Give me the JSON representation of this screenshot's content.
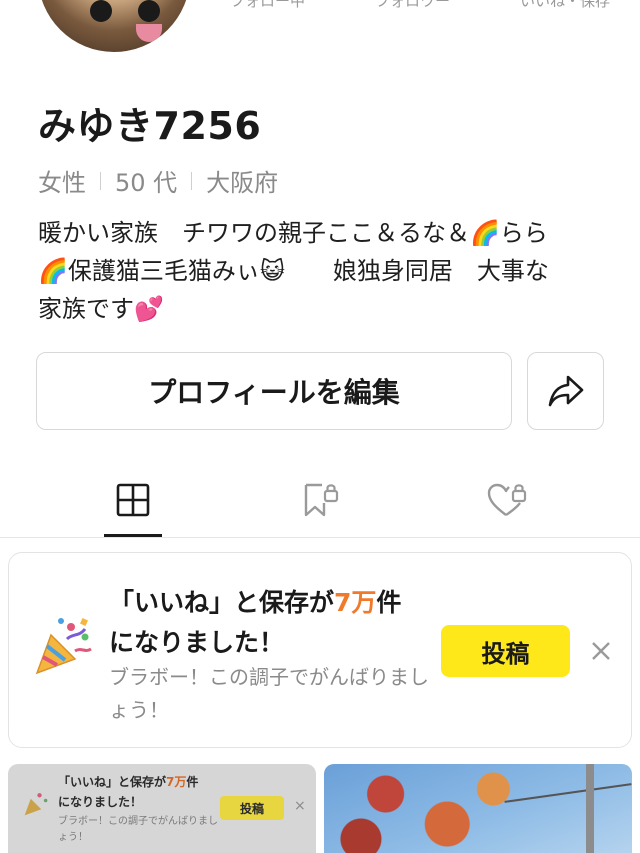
{
  "profile": {
    "username": "みゆき7256",
    "gender": "女性",
    "age": "50 代",
    "location": "大阪府",
    "bio": "暖かい家族　チワワの親子ここ＆るな＆🌈らら\n🌈保護猫三毛猫みぃ😺　　娘独身同居　大事な\n家族です💕"
  },
  "stats": {
    "following_label": "フォロー中",
    "followers_label": "フォロワー",
    "likes_label": "いいね・保存"
  },
  "actions": {
    "edit_profile_label": "プロフィールを編集"
  },
  "tabs": [
    {
      "icon": "grid-icon",
      "active": true
    },
    {
      "icon": "bookmark-lock-icon",
      "active": false
    },
    {
      "icon": "heart-lock-icon",
      "active": false
    }
  ],
  "notice": {
    "headline_pre": "「いいね」と保存が",
    "headline_highlight": "7万",
    "headline_post1": "件",
    "headline_post2": "になりました！",
    "subtext": "ブラボー！この調子でがんばりましょう！",
    "post_button_label": "投稿",
    "icon": "party-popper-icon",
    "highlight_color": "#f07a2a",
    "button_color": "#ffe81a"
  },
  "thumbnail_notice": {
    "headline_pre": "「いいね」と保存が",
    "headline_highlight": "7万",
    "headline_post1": "件",
    "headline_post2": "になりました！",
    "subtext": "ブラボー！この調子でがんばりましょう！",
    "post_button_label": "投稿",
    "close_symbol": "×"
  }
}
